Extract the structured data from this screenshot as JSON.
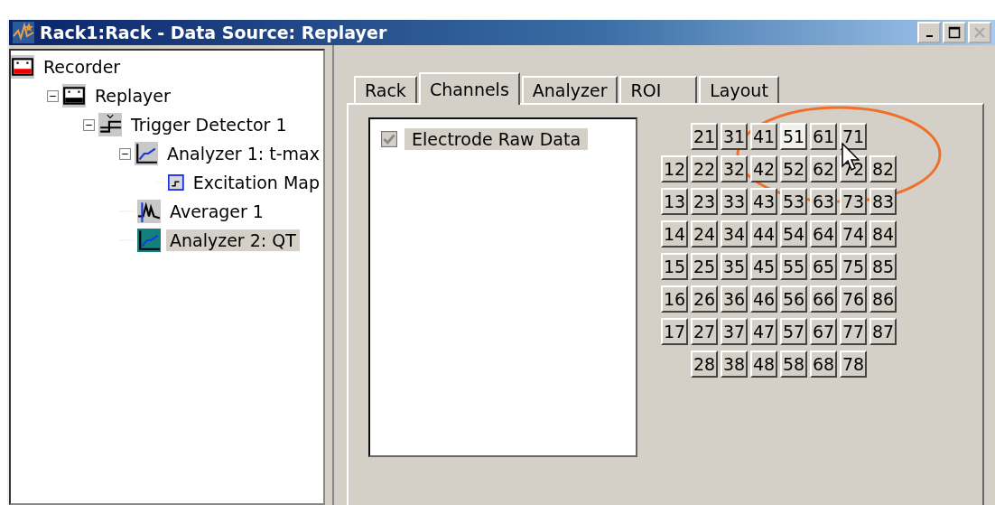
{
  "window": {
    "title": "Rack1:Rack - Data Source: Replayer",
    "buttons": [
      {
        "kind": "minimize",
        "disabled": false
      },
      {
        "kind": "maximize",
        "disabled": false
      },
      {
        "kind": "close",
        "disabled": true
      }
    ]
  },
  "tree": [
    {
      "label": "Recorder",
      "kind": "recorder",
      "selected": false,
      "children": [
        {
          "label": "Replayer",
          "kind": "replayer",
          "selected": false,
          "expanded": true,
          "children": [
            {
              "label": "Trigger Detector 1",
              "kind": "trigger",
              "selected": false,
              "expanded": true,
              "children": [
                {
                  "label": "Analyzer 1: t-max",
                  "kind": "analyzer",
                  "selected": false,
                  "expanded": true,
                  "children": [
                    {
                      "label": "Excitation Map",
                      "kind": "map",
                      "selected": false
                    }
                  ]
                },
                {
                  "label": "Averager 1",
                  "kind": "averager",
                  "selected": false
                },
                {
                  "label": "Analyzer 2: QT",
                  "kind": "analyzer",
                  "selected": true
                }
              ]
            }
          ]
        }
      ]
    }
  ],
  "tabs": [
    {
      "label": "Rack",
      "selected": false
    },
    {
      "label": "Channels",
      "selected": true
    },
    {
      "label": "Analyzer",
      "selected": false
    },
    {
      "label": "ROI",
      "selected": false
    },
    {
      "label": "Layout",
      "selected": false
    }
  ],
  "streams": [
    {
      "label": "Electrode Raw Data",
      "checked": true,
      "disabled": true
    }
  ],
  "electrode_grid": [
    {
      "indent": true,
      "cells": [
        {
          "label": "21",
          "selected": false
        },
        {
          "label": "31",
          "selected": false
        },
        {
          "label": "41",
          "selected": false
        },
        {
          "label": "51",
          "selected": true
        },
        {
          "label": "61",
          "selected": false
        },
        {
          "label": "71",
          "selected": false
        }
      ]
    },
    {
      "indent": false,
      "cells": [
        {
          "label": "12",
          "selected": false
        },
        {
          "label": "22",
          "selected": false
        },
        {
          "label": "32",
          "selected": false
        },
        {
          "label": "42",
          "selected": false
        },
        {
          "label": "52",
          "selected": false
        },
        {
          "label": "62",
          "selected": false
        },
        {
          "label": "72",
          "selected": false
        },
        {
          "label": "82",
          "selected": false
        }
      ]
    },
    {
      "indent": false,
      "cells": [
        {
          "label": "13",
          "selected": false
        },
        {
          "label": "23",
          "selected": false
        },
        {
          "label": "33",
          "selected": false
        },
        {
          "label": "43",
          "selected": false
        },
        {
          "label": "53",
          "selected": false
        },
        {
          "label": "63",
          "selected": false
        },
        {
          "label": "73",
          "selected": false
        },
        {
          "label": "83",
          "selected": false
        }
      ]
    },
    {
      "indent": false,
      "cells": [
        {
          "label": "14",
          "selected": false
        },
        {
          "label": "24",
          "selected": false
        },
        {
          "label": "34",
          "selected": false
        },
        {
          "label": "44",
          "selected": false
        },
        {
          "label": "54",
          "selected": false
        },
        {
          "label": "64",
          "selected": false
        },
        {
          "label": "74",
          "selected": false
        },
        {
          "label": "84",
          "selected": false
        }
      ]
    },
    {
      "indent": false,
      "cells": [
        {
          "label": "15",
          "selected": false
        },
        {
          "label": "25",
          "selected": false
        },
        {
          "label": "35",
          "selected": false
        },
        {
          "label": "45",
          "selected": false
        },
        {
          "label": "55",
          "selected": false
        },
        {
          "label": "65",
          "selected": false
        },
        {
          "label": "75",
          "selected": false
        },
        {
          "label": "85",
          "selected": false
        }
      ]
    },
    {
      "indent": false,
      "cells": [
        {
          "label": "16",
          "selected": false
        },
        {
          "label": "26",
          "selected": false
        },
        {
          "label": "36",
          "selected": false
        },
        {
          "label": "46",
          "selected": false
        },
        {
          "label": "56",
          "selected": false
        },
        {
          "label": "66",
          "selected": false
        },
        {
          "label": "76",
          "selected": false
        },
        {
          "label": "86",
          "selected": false
        }
      ]
    },
    {
      "indent": false,
      "cells": [
        {
          "label": "17",
          "selected": false
        },
        {
          "label": "27",
          "selected": false
        },
        {
          "label": "37",
          "selected": false
        },
        {
          "label": "47",
          "selected": false
        },
        {
          "label": "57",
          "selected": false
        },
        {
          "label": "67",
          "selected": false
        },
        {
          "label": "77",
          "selected": false
        },
        {
          "label": "87",
          "selected": false
        }
      ]
    },
    {
      "indent": true,
      "cells": [
        {
          "label": "28",
          "selected": false
        },
        {
          "label": "38",
          "selected": false
        },
        {
          "label": "48",
          "selected": false
        },
        {
          "label": "58",
          "selected": false
        },
        {
          "label": "68",
          "selected": false
        },
        {
          "label": "78",
          "selected": false
        }
      ]
    }
  ]
}
